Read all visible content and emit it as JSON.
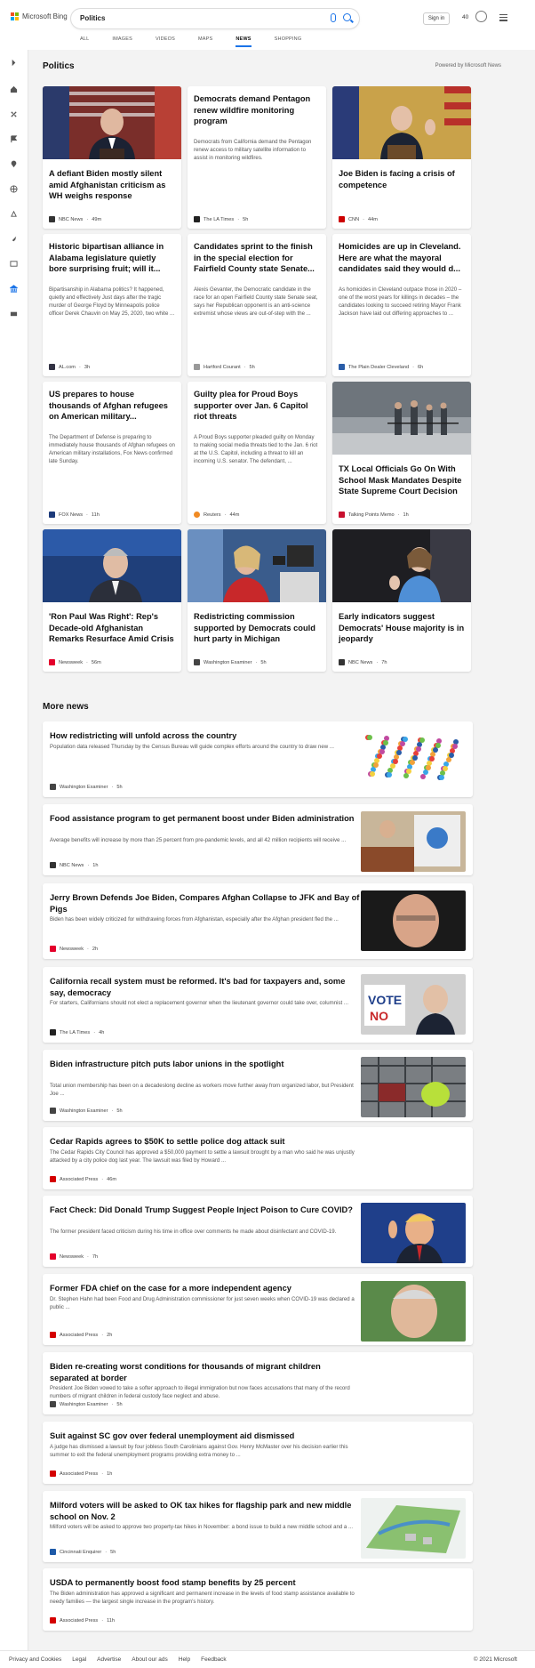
{
  "header": {
    "brand": "Microsoft Bing",
    "search_value": "Politics",
    "signin_label": "Sign in",
    "points": "40",
    "tabs": [
      "ALL",
      "IMAGES",
      "VIDEOS",
      "MAPS",
      "NEWS",
      "SHOPPING"
    ],
    "active_tab": "NEWS"
  },
  "section": {
    "title": "Politics",
    "powered_by": "Powered by Microsoft News"
  },
  "cards": [
    {
      "title": "A defiant Biden mostly silent amid Afghanistan criticism as WH weighs response",
      "desc": "",
      "source": "NBC News",
      "age": "49m",
      "favicon_color": "#333"
    },
    {
      "title": "Democrats demand Pentagon renew wildfire monitoring program",
      "desc": "Democrats from California demand the Pentagon renew access to military satellite information to assist in monitoring wildfires.",
      "source": "The LA Times",
      "age": "5h",
      "favicon_color": "#222"
    },
    {
      "title": "Joe Biden is facing a crisis of competence",
      "desc": "",
      "source": "CNN",
      "age": "44m",
      "favicon_color": "#cc0000"
    },
    {
      "title": "Historic bipartisan alliance in Alabama legislature quietly bore surprising fruit; will it...",
      "desc": "Bipartisanship in Alabama politics? It happened, quietly and effectively Just days after the tragic murder of George Floyd by Minneapolis police officer Derek Chauvin on May 25, 2020, two white ...",
      "source": "AL.com",
      "age": "3h",
      "favicon_color": "#334"
    },
    {
      "title": "Candidates sprint to the finish in the special election for Fairfield County state Senate...",
      "desc": "Alexis Gevanter, the Democratic candidate in the race for an open Fairfield County state Senate seat, says her Republican opponent is an anti-science extremist whose views are out-of-step with the ...",
      "source": "Hartford Courant",
      "age": "5h",
      "favicon_color": "#999"
    },
    {
      "title": "Homicides are up in Cleveland. Here are what the mayoral candidates said they would d...",
      "desc": "As homicides in Cleveland outpace those in 2020 – one of the worst years for killings in decades – the candidates looking to succeed retiring Mayor Frank Jackson have laid out differing approaches to ...",
      "source": "The Plain Dealer Cleveland",
      "age": "6h",
      "favicon_color": "#2a5da8"
    },
    {
      "title": "US prepares to house thousands of Afghan refugees on American military...",
      "desc": "The Department of Defense is preparing to immediately house thousands of Afghan refugees on American military installations, Fox News confirmed late Sunday.",
      "source": "FOX News",
      "age": "11h",
      "favicon_color": "#1c3a7a"
    },
    {
      "title": "Guilty plea for Proud Boys supporter over Jan. 6 Capitol riot threats",
      "desc": "A Proud Boys supporter pleaded guilty on Monday to making social media threats tied to the Jan. 6 riot at the U.S. Capitol, including a threat to kill an incoming U.S. senator. The defendant, ...",
      "source": "Reuters",
      "age": "44m",
      "favicon_color": "#f08a24"
    },
    {
      "title": "TX Local Officials Go On With School Mask Mandates Despite State Supreme Court Decision",
      "desc": "",
      "source": "Talking Points Memo",
      "age": "1h",
      "favicon_color": "#c8102e"
    },
    {
      "title": "'Ron Paul Was Right': Rep's Decade-old Afghanistan Remarks Resurface Amid Crisis",
      "desc": "",
      "source": "Newsweek",
      "age": "56m",
      "favicon_color": "#e4002b"
    },
    {
      "title": "Redistricting commission supported by Democrats could hurt party in Michigan",
      "desc": "",
      "source": "Washington Examiner",
      "age": "5h",
      "favicon_color": "#444"
    },
    {
      "title": "Early indicators suggest Democrats' House majority is in jeopardy",
      "desc": "",
      "source": "NBC News",
      "age": "7h",
      "favicon_color": "#333"
    }
  ],
  "more_news": {
    "title": "More news",
    "items": [
      {
        "title": "How redistricting will unfold across the country",
        "desc": "Population data released Thursday by the Census Bureau will guide complex efforts around the country to draw new ...",
        "source": "Washington Examiner",
        "age": "5h",
        "favicon_color": "#444"
      },
      {
        "title": "Food assistance program to get permanent boost under Biden administration",
        "desc": "Average benefits will increase by more than 25 percent from pre-pandemic levels, and all 42 million recipients will receive ...",
        "source": "NBC News",
        "age": "1h",
        "favicon_color": "#333"
      },
      {
        "title": "Jerry Brown Defends Joe Biden, Compares Afghan Collapse to JFK and Bay of Pigs",
        "desc": "Biden has been widely criticized for withdrawing forces from Afghanistan, especially after the Afghan president fled the ...",
        "source": "Newsweek",
        "age": "2h",
        "favicon_color": "#e4002b"
      },
      {
        "title": "California recall system must be reformed. It's bad for taxpayers and, some say, democracy",
        "desc": "For starters, Californians should not elect a replacement governor when the lieutenant governor could take over, columnist ...",
        "source": "The LA Times",
        "age": "4h",
        "favicon_color": "#222"
      },
      {
        "title": "Biden infrastructure pitch puts labor unions in the spotlight",
        "desc": "Total union membership has been on a decadeslong decline as workers move further away from organized labor, but President Joe ...",
        "source": "Washington Examiner",
        "age": "5h",
        "favicon_color": "#444"
      },
      {
        "title": "Cedar Rapids agrees to $50K to settle police dog attack suit",
        "desc": "The Cedar Rapids City Council has approved a $50,000 payment to settle a lawsuit brought by a man who said he was unjustly attacked by a city police dog last year. The lawsuit was filed by Howard ...",
        "source": "Associated Press",
        "age": "46m",
        "favicon_color": "#d40000"
      },
      {
        "title": "Fact Check: Did Donald Trump Suggest People Inject Poison to Cure COVID?",
        "desc": "The former president faced criticism during his time in office over comments he made about disinfectant and COVID-19.",
        "source": "Newsweek",
        "age": "7h",
        "favicon_color": "#e4002b"
      },
      {
        "title": "Former FDA chief on the case for a more independent agency",
        "desc": "Dr. Stephen Hahn had been Food and Drug Administration commissioner for just seven weeks when COVID-19 was declared a public ...",
        "source": "Associated Press",
        "age": "2h",
        "favicon_color": "#d40000"
      },
      {
        "title": "Biden re-creating worst conditions for thousands of migrant children separated at border",
        "desc": "President Joe Biden vowed to take a softer approach to illegal immigration but now faces accusations that many of the record numbers of migrant children in federal custody face neglect and abuse.",
        "source": "Washington Examiner",
        "age": "5h",
        "favicon_color": "#444"
      },
      {
        "title": "Suit against SC gov over federal unemployment aid dismissed",
        "desc": "A judge has dismissed a lawsuit by four jobless South Carolinians against Gov. Henry McMaster over his decision earlier this summer to exit the federal unemployment programs providing extra money to ...",
        "source": "Associated Press",
        "age": "1h",
        "favicon_color": "#d40000"
      },
      {
        "title": "Milford voters will be asked to OK tax hikes for flagship park and new middle school on Nov. 2",
        "desc": "Milford voters will be asked to approve two property-tax hikes in November: a bond issue to build a new middle school and a ...",
        "source": "Cincinnati Enquirer",
        "age": "5h",
        "favicon_color": "#1e5aa8"
      },
      {
        "title": "USDA to permanently boost food stamp benefits by 25 percent",
        "desc": "The Biden administration has approved a significant and permanent increase in the levels of food stamp assistance available to needy families — the largest single increase in the program's history.",
        "source": "Associated Press",
        "age": "11h",
        "favicon_color": "#d40000"
      }
    ]
  },
  "footer": {
    "links": [
      "Privacy and Cookies",
      "Legal",
      "Advertise",
      "About our ads",
      "Help",
      "Feedback"
    ],
    "copyright": "© 2021 Microsoft"
  }
}
